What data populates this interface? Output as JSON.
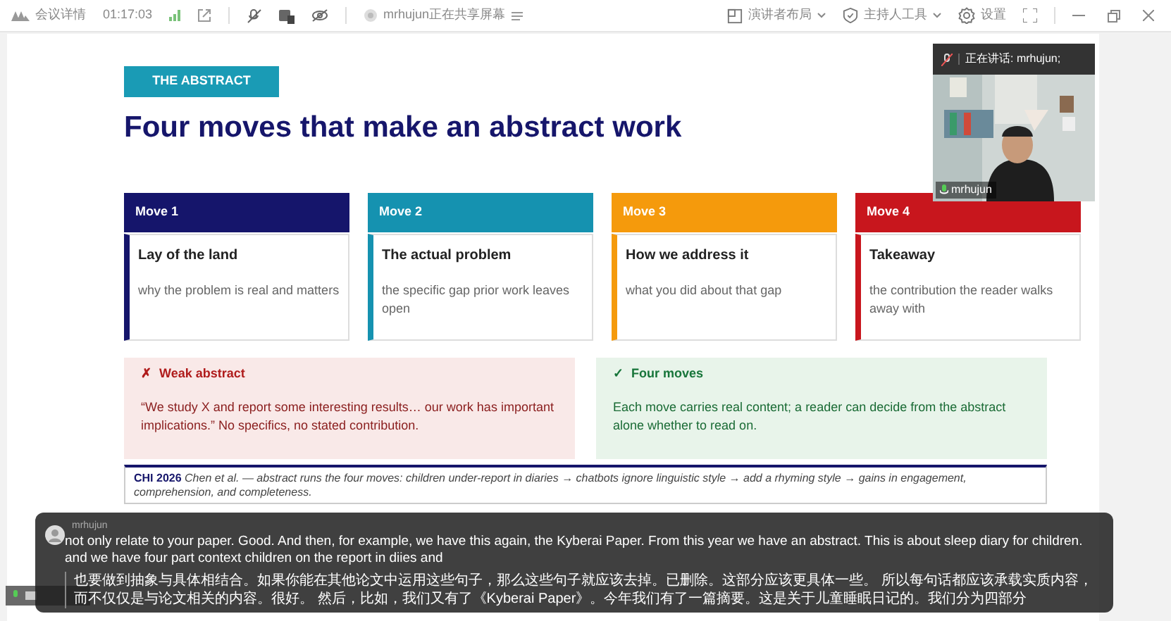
{
  "toolbar": {
    "title": "会议详情",
    "timer": "01:17:03",
    "sharer": "mrhujun正在共享屏幕",
    "right_items": [
      {
        "label": "演讲者布局",
        "kind": "layout"
      },
      {
        "label": "主持人工具",
        "kind": "host"
      },
      {
        "label": "设置",
        "kind": "settings"
      }
    ]
  },
  "slide": {
    "badge": "THE ABSTRACT",
    "title": "Four moves that make an abstract work",
    "moves": [
      {
        "header": "Move 1",
        "title": "Lay of the land",
        "text": "why the problem is real and matters",
        "color": "#15156b"
      },
      {
        "header": "Move 2",
        "title": "The actual problem",
        "text": "the specific gap prior work leaves open",
        "color": "#1592b0"
      },
      {
        "header": "Move 3",
        "title": "How we address it",
        "text": "what you did about that gap",
        "color": "#f59a0c"
      },
      {
        "header": "Move 4",
        "title": "Takeaway",
        "text": "the contribution the reader walks away with",
        "color": "#c8161d"
      }
    ],
    "verdicts": [
      {
        "kind": "bad",
        "mark": "✗",
        "title": "Weak abstract",
        "text": "“We study X and report some interesting results… our work has important implications.”  No specifics, no stated contribution."
      },
      {
        "kind": "good",
        "mark": "✓",
        "title": "Four moves",
        "text": "Each move carries real content; a reader can decide from the abstract alone whether to read on."
      }
    ],
    "reference": "**CHI 2026** *Chen et al. — abstract runs the four moves: children under-report in diaries → chatbots ignore linguistic style → add a rhyming style → gains in engagement, comprehension, and completeness.*"
  },
  "video": {
    "speaking": "正在讲话:  mrhujun;",
    "name": "mrhujun"
  },
  "caption": {
    "speaker": "mrhujun",
    "english": "not only relate to your paper. Good. And then, for example, we have this again, the Kyberai Paper. From this year we have an abstract. This is about sleep diary for children. and we have four part context children on the report in diies and",
    "chinese": "也要做到抽象与具体相结合。如果你能在其他论文中运用这些句子，那么这些句子就应该去掉。已删除。这部分应该更具体一些。 所以每句话都应该承载实质内容，而不仅仅是与论文相关的内容。很好。 然后，比如，我们又有了《Kyberai Paper》。今年我们有了一篇摘要。这是关于儿童睡眠日记的。我们分为四部分"
  }
}
